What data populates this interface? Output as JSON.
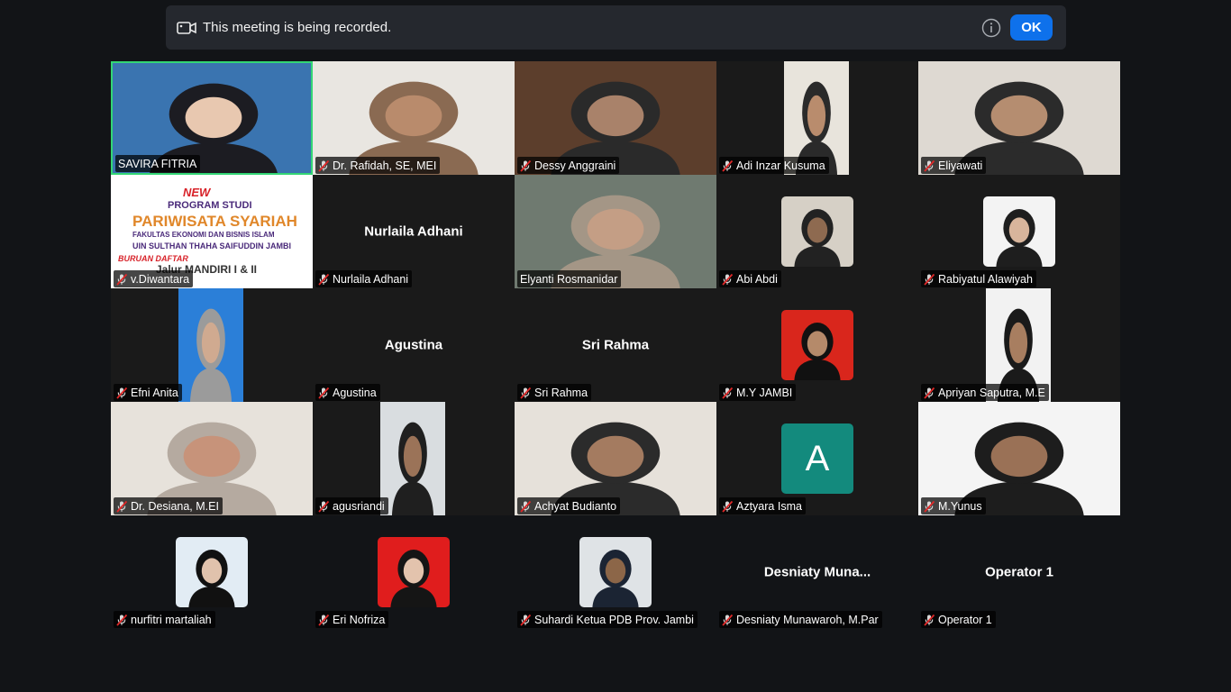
{
  "banner": {
    "message": "This meeting is being recorded.",
    "ok_label": "OK"
  },
  "poster": {
    "new": "NEW",
    "program": "PROGRAM STUDI",
    "title": "PARIWISATA SYARIAH",
    "faculty": "FAKULTAS EKONOMI DAN BISNIS ISLAM",
    "university": "UIN SULTHAN THAHA SAIFUDDIN JAMBI",
    "buruan": "BURUAN DAFTAR",
    "jalur": "Jalur MANDIRI I & II"
  },
  "participants": [
    {
      "name": "SAVIRA FITRIA",
      "muted": false,
      "video": "photo",
      "bg": "#3a74b0",
      "skin": "#e8c8b0",
      "hijab": "#1c1c22",
      "active": true
    },
    {
      "name": "Dr. Rafidah, SE, MEI",
      "muted": true,
      "video": "photo",
      "bg": "#e9e6e1",
      "skin": "#b98b6c",
      "hijab": "#8a6a52"
    },
    {
      "name": "Dessy Anggraini",
      "muted": true,
      "video": "photo",
      "bg": "#5c3e2c",
      "skin": "#a9826a",
      "hijab": "#2a2a2a"
    },
    {
      "name": "Adi Inzar Kusuma",
      "muted": true,
      "video": "narrow",
      "bg": "#e8e4dc",
      "skin": "#b98c6d",
      "hijab": "#2a2a2a"
    },
    {
      "name": "Eliyawati",
      "muted": true,
      "video": "photo",
      "bg": "#ded9d2",
      "skin": "#b58d70",
      "hijab": "#2b2b2b"
    },
    {
      "name": "v.Diwantara",
      "muted": true,
      "video": "poster"
    },
    {
      "name": "Nurlaila Adhani",
      "muted": true,
      "video": "none"
    },
    {
      "name": "Elyanti Rosmanidar",
      "muted": false,
      "video": "photo",
      "bg": "#6f7a70",
      "skin": "#c49e85",
      "hijab": "#a49686"
    },
    {
      "name": "Abi Abdi",
      "muted": true,
      "video": "avatar",
      "bg": "#d6d0c6",
      "skin": "#8e6a50",
      "hijab": "#222222"
    },
    {
      "name": "Rabiyatul Alawiyah",
      "muted": true,
      "video": "avatar",
      "bg": "#f3f3f3",
      "skin": "#d8b59c",
      "hijab": "#1e1e1e"
    },
    {
      "name": "Efni Anita",
      "muted": true,
      "video": "narrow",
      "bg": "#2b7fd8",
      "skin": "#d0aa90",
      "hijab": "#9b9b9b"
    },
    {
      "name": "Agustina",
      "muted": true,
      "video": "none"
    },
    {
      "name": "Sri Rahma",
      "muted": true,
      "video": "none"
    },
    {
      "name": "M.Y JAMBI",
      "muted": true,
      "video": "avatar",
      "bg": "#d9261c",
      "skin": "#b58a6a",
      "hijab": "#111111"
    },
    {
      "name": "Apriyan Saputra, M.E",
      "muted": true,
      "video": "narrow",
      "bg": "#f2f2f2",
      "skin": "#a87e60",
      "hijab": "#1a1a1a"
    },
    {
      "name": "Dr. Desiana, M.EI",
      "muted": true,
      "video": "photo",
      "bg": "#e7e2db",
      "skin": "#c7937a",
      "hijab": "#b5aaa0"
    },
    {
      "name": "agusriandi",
      "muted": true,
      "video": "narrow",
      "bg": "#d9dde0",
      "skin": "#9b7358",
      "hijab": "#1f1f1f"
    },
    {
      "name": "Achyat Budianto",
      "muted": true,
      "video": "photo",
      "bg": "#e6e1da",
      "skin": "#a47b60",
      "hijab": "#2b2b2b"
    },
    {
      "name": "Aztyara Isma",
      "muted": true,
      "video": "letter",
      "letter": "A"
    },
    {
      "name": "M.Yunus",
      "muted": true,
      "video": "photo",
      "bg": "#f4f4f4",
      "skin": "#9a7156",
      "hijab": "#1d1d1d"
    },
    {
      "name": "nurfitri martaliah",
      "muted": true,
      "video": "avatar",
      "bg": "#e2ecf4",
      "skin": "#e0c2ac",
      "hijab": "#111111"
    },
    {
      "name": "Eri Nofriza",
      "muted": true,
      "video": "avatar",
      "bg": "#e01d1d",
      "skin": "#e3c3ad",
      "hijab": "#151515"
    },
    {
      "name": "Suhardi Ketua PDB Prov. Jambi",
      "muted": true,
      "video": "avatar",
      "bg": "#dfe3e6",
      "skin": "#8c6648",
      "hijab": "#1b2433"
    },
    {
      "name": "Desniaty Munawaroh, M.Par",
      "display": "Desniaty  Muna...",
      "muted": true,
      "video": "none"
    },
    {
      "name": "Operator 1",
      "muted": true,
      "video": "none"
    }
  ]
}
